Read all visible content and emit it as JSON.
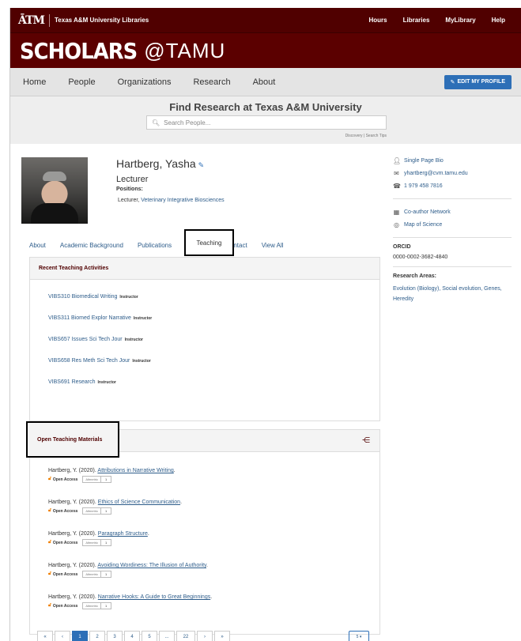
{
  "topbar": {
    "logo": "ĀTM",
    "library": "Texas A&M University Libraries",
    "links": [
      "Hours",
      "Libraries",
      "MyLibrary",
      "Help"
    ]
  },
  "banner": {
    "main": "SCHOLARS",
    "suffix": "@TAMU"
  },
  "nav": {
    "items": [
      "Home",
      "People",
      "Organizations",
      "Research",
      "About"
    ],
    "edit_button": "EDIT MY PROFILE"
  },
  "search": {
    "title": "Find Research at Texas A&M University",
    "placeholder": "Search People...",
    "tips": "Discovery | Search Tips"
  },
  "profile": {
    "name": "Hartberg, Yasha",
    "title": "Lecturer",
    "positions_label": "Positions:",
    "position_role": "Lecturer,",
    "position_unit": "Veterinary Integrative Biosciences"
  },
  "sidebar": {
    "links": [
      {
        "icon": "person-icon",
        "label": "Single Page Bio"
      },
      {
        "icon": "envelope-icon",
        "label": "yhartberg@cvm.tamu.edu"
      },
      {
        "icon": "phone-icon",
        "label": "1 979 458 7816"
      }
    ],
    "tools": [
      {
        "icon": "network-icon",
        "label": "Co-author Network"
      },
      {
        "icon": "globe-icon",
        "label": "Map of Science"
      }
    ],
    "orcid_label": "ORCID",
    "orcid_value": "0000-0002-3682-4840",
    "research_areas_label": "Research Areas:",
    "research_areas_value": "Evolution (Biology), Social evolution, Genes, Heredity"
  },
  "tabs": [
    "About",
    "Academic Background",
    "Publications",
    "Teaching",
    "Contact",
    "View All"
  ],
  "teaching": {
    "header": "Recent Teaching Activities",
    "items": [
      {
        "course": "VIBS310 Biomedical Writing",
        "role": "Instructor"
      },
      {
        "course": "VIBS311 Biomed Explor Narrative",
        "role": "Instructor"
      },
      {
        "course": "VIBS657 Issues Sci Tech Jour",
        "role": "Instructor"
      },
      {
        "course": "VIBS658 Res Meth Sci Tech Jour",
        "role": "Instructor"
      },
      {
        "course": "VIBS691 Research",
        "role": "Instructor"
      }
    ]
  },
  "materials": {
    "header": "Open Teaching Materials",
    "open_access": "Open Access",
    "altmetric": "Altmetric",
    "items": [
      {
        "cite": "Hartberg, Y. (2020).",
        "title": "Attributions in Narrative Writing",
        "score": "1"
      },
      {
        "cite": "Hartberg, Y. (2020).",
        "title": "Ethics of Science Communication",
        "score": "1"
      },
      {
        "cite": "Hartberg, Y. (2020).",
        "title": "Paragraph Structure",
        "score": "1"
      },
      {
        "cite": "Hartberg, Y. (2020).",
        "title": "Avoiding Wordiness: The Illusion of Authority",
        "score": "1"
      },
      {
        "cite": "Hartberg, Y. (2020).",
        "title": "Narrative Hooks: A Guide to Great Beginnings",
        "score": "1"
      }
    ]
  },
  "pager": {
    "buttons": [
      "«",
      "‹",
      "1",
      "2",
      "3",
      "4",
      "5",
      "...",
      "22",
      "›",
      "»"
    ],
    "per_page": "5 ▾"
  }
}
